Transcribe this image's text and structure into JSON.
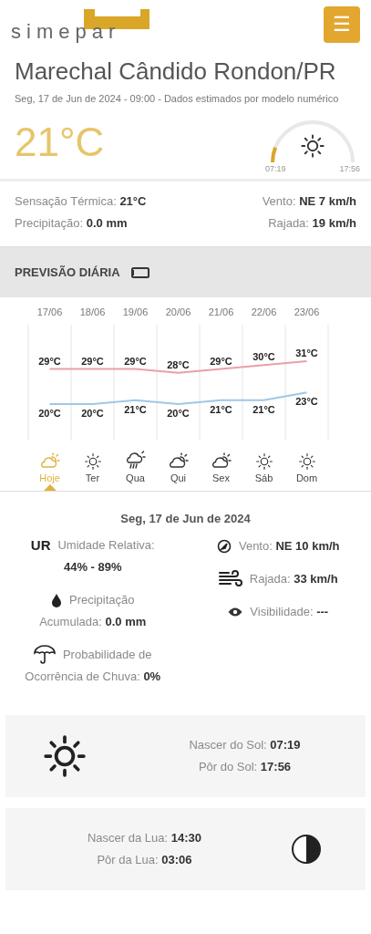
{
  "header": {
    "logo": "simepar",
    "menu_icon": "☰"
  },
  "current": {
    "city": "Marechal Cândido Rondon/PR",
    "subtitle": "Seg, 17 de Jun de 2024 - 09:00 - Dados estimados por modelo numérico",
    "temperature": "21°C",
    "sun_arc": {
      "sunrise": "07:19",
      "sunset": "17:56"
    }
  },
  "conditions": [
    {
      "label": "Sensação Térmica:",
      "value": "21°C"
    },
    {
      "label": "Vento:",
      "value": "NE 7 km/h"
    },
    {
      "label": "Precipitação:",
      "value": "0.0 mm"
    },
    {
      "label": "Rajada:",
      "value": "19 km/h"
    }
  ],
  "daily_forecast": {
    "title": "PREVISÃO DIÁRIA",
    "chart_data": {
      "type": "line",
      "categories": [
        "17/06",
        "18/06",
        "19/06",
        "20/06",
        "21/06",
        "22/06",
        "23/06"
      ],
      "series": [
        {
          "color": "#e8a0a8",
          "values": [
            29,
            29,
            29,
            28,
            29,
            30,
            31
          ],
          "value_labels": [
            "29°C",
            "29°C",
            "29°C",
            "28°C",
            "29°C",
            "30°C",
            "31°C"
          ]
        },
        {
          "color": "#9ec8e8",
          "values": [
            20,
            20,
            21,
            20,
            21,
            21,
            23
          ],
          "value_labels": [
            "20°C",
            "20°C",
            "21°C",
            "20°C",
            "21°C",
            "21°C",
            "23°C"
          ]
        }
      ]
    },
    "days": [
      {
        "label": "Hoje",
        "kind": "partly-cloudy",
        "selected": true
      },
      {
        "label": "Ter",
        "kind": "sunny",
        "selected": false
      },
      {
        "label": "Qua",
        "kind": "rain",
        "selected": false
      },
      {
        "label": "Qui",
        "kind": "partly-cloudy",
        "selected": false
      },
      {
        "label": "Sex",
        "kind": "partly-cloudy",
        "selected": false
      },
      {
        "label": "Sáb",
        "kind": "sunny",
        "selected": false
      },
      {
        "label": "Dom",
        "kind": "sunny",
        "selected": false
      }
    ]
  },
  "day_detail": {
    "date": "Seg, 17 de Jun de 2024",
    "left": [
      {
        "kind": "humidity",
        "badge": "UR",
        "label": "Umidade Relativa:",
        "value": "44% - 89%"
      },
      {
        "kind": "precipitation",
        "label": "Precipitação",
        "label2": "Acumulada:",
        "value": "0.0 mm"
      },
      {
        "kind": "rain-chance",
        "label": "Probabilidade de",
        "label2": "Ocorrência de Chuva:",
        "value": "0%"
      }
    ],
    "right": [
      {
        "kind": "wind",
        "label": "Vento:",
        "value": "NE 10 km/h"
      },
      {
        "kind": "gust",
        "label": "Rajada:",
        "value": "33 km/h"
      },
      {
        "kind": "visibility",
        "label": "Visibilidade:",
        "value": "---"
      }
    ]
  },
  "sun": {
    "rise_label": "Nascer do Sol:",
    "rise": "07:19",
    "set_label": "Pôr do Sol:",
    "set": "17:56"
  },
  "moon": {
    "rise_label": "Nascer da Lua:",
    "rise": "14:30",
    "set_label": "Pôr da Lua:",
    "set": "03:06"
  }
}
